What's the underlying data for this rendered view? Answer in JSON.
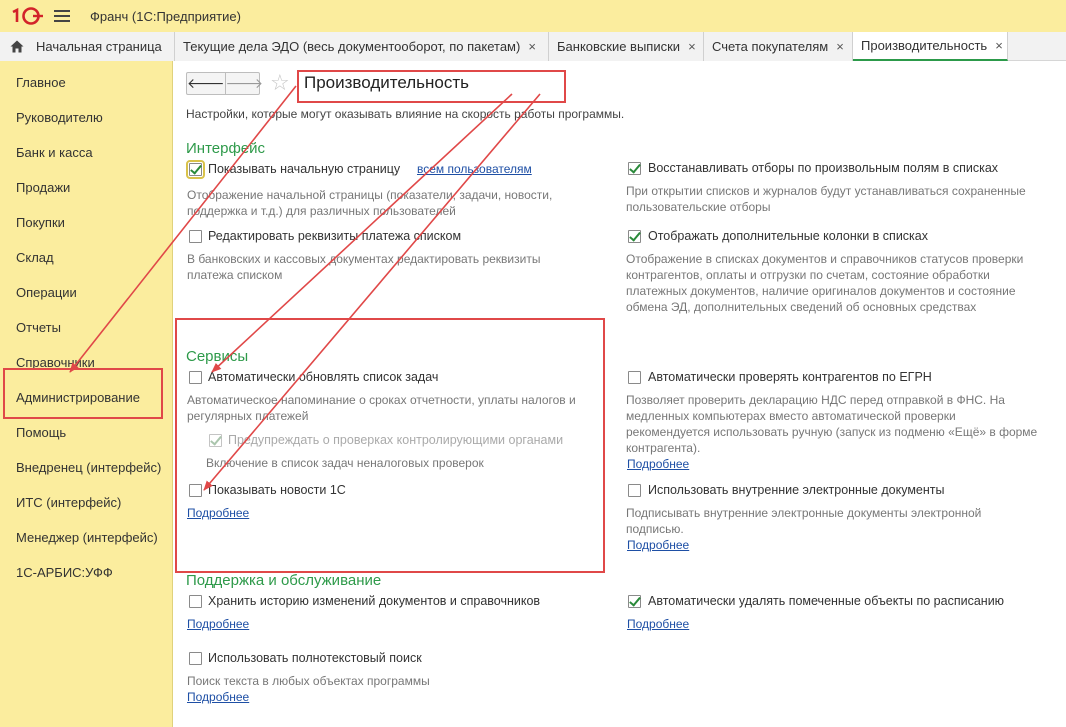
{
  "titlebar": {
    "app_title": "Франч  (1С:Предприятие)"
  },
  "tabs": [
    {
      "label": "Начальная страница"
    },
    {
      "label": "Текущие дела ЭДО (весь документооборот, по пакетам)"
    },
    {
      "label": "Банковские выписки"
    },
    {
      "label": "Счета покупателям"
    },
    {
      "label": "Производительность"
    }
  ],
  "close_glyph": "×",
  "sidebar": {
    "items": [
      {
        "label": "Главное"
      },
      {
        "label": "Руководителю"
      },
      {
        "label": "Банк и касса"
      },
      {
        "label": "Продажи"
      },
      {
        "label": "Покупки"
      },
      {
        "label": "Склад"
      },
      {
        "label": "Операции"
      },
      {
        "label": "Отчеты"
      },
      {
        "label": "Справочники"
      },
      {
        "label": "Администрирование"
      },
      {
        "label": "Помощь"
      },
      {
        "label": "Внедренец (интерфейс)"
      },
      {
        "label": "ИТС (интерфейс)"
      },
      {
        "label": "Менеджер (интерфейс)"
      },
      {
        "label": "1С-АРБИС:УФФ"
      }
    ]
  },
  "page": {
    "back_glyph": "🡐",
    "forward_glyph": "🡒",
    "star_glyph": "☆",
    "title": "Производительность",
    "description": "Настройки, которые могут оказывать влияние на скорость работы программы."
  },
  "interface": {
    "heading": "Интерфейс",
    "show_home": {
      "label": "Показывать начальную страницу",
      "link": "всем пользователям",
      "checked": true,
      "hint": "Отображение начальной страницы (показатели, задачи, новости, поддержка и т.д.) для различных пользователей"
    },
    "edit_payment": {
      "label": "Редактировать реквизиты платежа списком",
      "checked": false,
      "hint": "В банковских и кассовых документах редактировать реквизиты платежа списком"
    },
    "restore_filters": {
      "label": "Восстанавливать отборы по произвольным полям в списках",
      "checked": true,
      "hint": "При открытии списков и журналов будут устанавливаться сохраненные пользовательские отборы"
    },
    "extra_columns": {
      "label": "Отображать дополнительные колонки в списках",
      "checked": true,
      "hint": "Отображение в списках документов и справочников статусов проверки контрагентов, оплаты и отгрузки по счетам, состояние обработки платежных документов, наличие оригиналов документов и состояние обмена ЭД, дополнительных сведений об основных средствах"
    }
  },
  "services": {
    "heading": "Сервисы",
    "auto_tasks": {
      "label": "Автоматически обновлять список задач",
      "checked": false,
      "hint": "Автоматическое напоминание о сроках отчетности, уплаты налогов и регулярных платежей"
    },
    "warn_checks": {
      "label": "Предупреждать о проверках контролирующими органами",
      "checked": true,
      "hint": "Включение в список задач неналоговых проверок"
    },
    "show_news": {
      "label": "Показывать новости 1С",
      "checked": false,
      "link": "Подробнее"
    },
    "check_egrn": {
      "label": "Автоматически проверять контрагентов по ЕГРН",
      "checked": false,
      "hint": "Позволяет проверить декларацию НДС перед отправкой в ФНС. На медленных компьютерах вместо автоматической проверки рекомендуется использовать ручную (запуск из подменю «Ещё» в форме контрагента).",
      "link": "Подробнее"
    },
    "internal_docs": {
      "label": "Использовать внутренние электронные документы",
      "checked": false,
      "hint": "Подписывать внутренние электронные документы электронной подписью.",
      "link": "Подробнее"
    }
  },
  "support": {
    "heading": "Поддержка и обслуживание",
    "history": {
      "label": "Хранить историю изменений документов и справочников",
      "checked": false,
      "link": "Подробнее"
    },
    "fulltext": {
      "label": "Использовать полнотекстовый поиск",
      "checked": false,
      "hint": "Поиск текста в любых объектах программы",
      "link": "Подробнее"
    },
    "auto_delete": {
      "label": "Автоматически удалять помеченные объекты по расписанию",
      "checked": true,
      "link": "Подробнее"
    }
  },
  "colors": {
    "yellow": "#fbed9e",
    "green_heading": "#2e9a4a",
    "link": "#1e4fa5",
    "annotation_red": "#e04848"
  }
}
